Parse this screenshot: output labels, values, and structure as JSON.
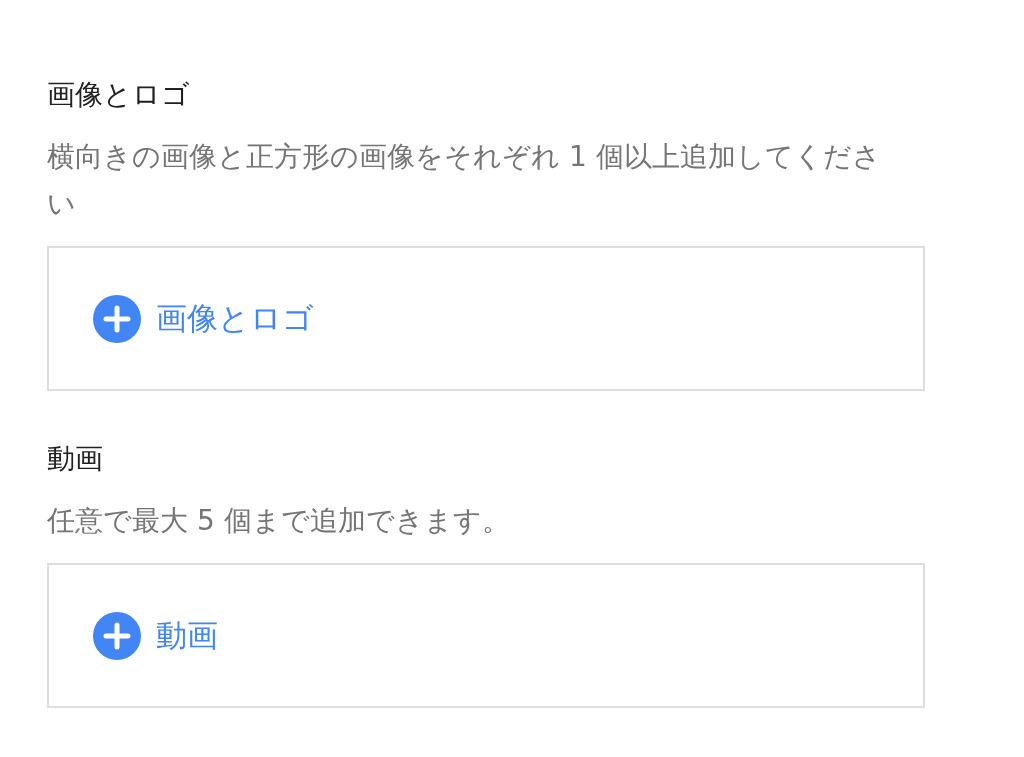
{
  "sections": [
    {
      "title": "画像とロゴ",
      "description": "横向きの画像と正方形の画像をそれぞれ 1 個以上追加してください",
      "add_button": {
        "label": "画像とロゴ"
      }
    },
    {
      "title": "動画",
      "description": "任意で最大 5 個まで追加できます。",
      "add_button": {
        "label": "動画"
      }
    }
  ]
}
